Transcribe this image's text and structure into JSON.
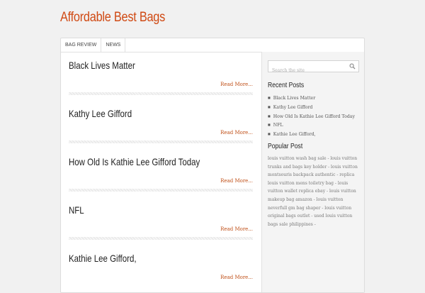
{
  "site": {
    "title": "Affordable Best Bags"
  },
  "nav": {
    "items": [
      {
        "label": "BAG REVIEW"
      },
      {
        "label": "NEWS"
      }
    ]
  },
  "posts": [
    {
      "title": "Black Lives Matter",
      "read_more": "Read More..."
    },
    {
      "title": "Kathy Lee Gifford",
      "read_more": "Read More..."
    },
    {
      "title": "How Old Is Kathie Lee Gifford Today",
      "read_more": "Read More..."
    },
    {
      "title": "NFL",
      "read_more": "Read More..."
    },
    {
      "title": "Kathie Lee Gifford,",
      "read_more": "Read More..."
    }
  ],
  "sidebar": {
    "search": {
      "placeholder": "Search the site"
    },
    "recent_posts": {
      "title": "Recent Posts",
      "items": [
        "Black Lives Matter",
        "Kathy Lee Gifford",
        "How Old Is Kathie Lee Gifford Today",
        "NFL",
        "Kathie Lee Gifford,"
      ]
    },
    "popular_post": {
      "title": "Popular Post",
      "text": "louis vuitton wash bag sale - louis vuitton trunks and bags key holder - louis vuitton montsouris backpack authentic - replica louis vuitton mens toiletry bag - louis vuitton wallet replica ebay - louis vuitton makeup bag amazon - louis vuitton neverfull gm bag shaper - louis vuitton original bags outlet - used louis vuitton bags sale philippines -"
    }
  },
  "colors": {
    "brand": "#d04a14",
    "link": "#c05018"
  },
  "icons": {
    "search": "search-icon"
  }
}
